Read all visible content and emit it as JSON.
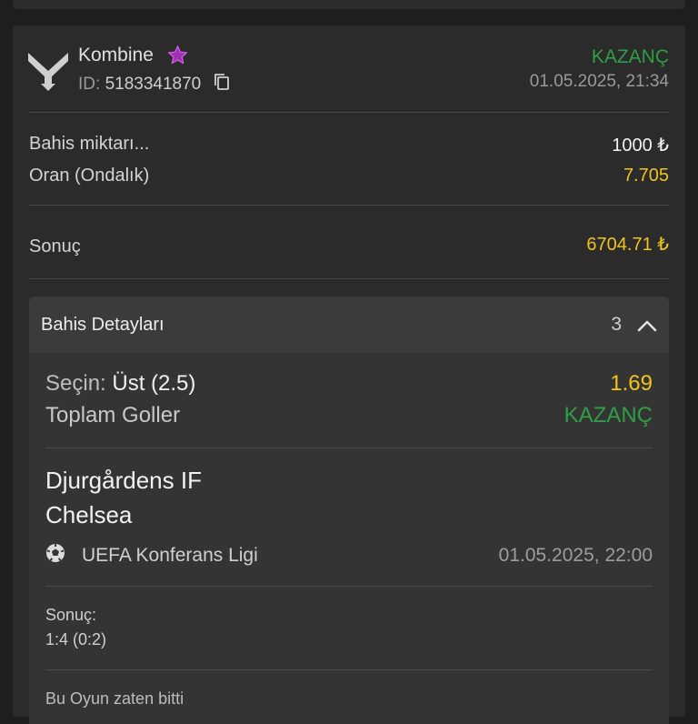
{
  "bet": {
    "type_label": "Kombine",
    "id_label": "ID:",
    "id_value": "5183341870",
    "status": "KAZANÇ",
    "placed_at": "01.05.2025, 21:34"
  },
  "summary": {
    "stake_label": "Bahis miktarı...",
    "stake_value": "1000 ₺",
    "odds_label": "Oran (Ondalık)",
    "odds_value": "7.705",
    "result_label": "Sonuç",
    "result_value": "6704.71 ₺"
  },
  "details": {
    "title": "Bahis Detayları",
    "count": "3",
    "selection": {
      "pick_label": "Seçin:",
      "pick_value": "Üst (2.5)",
      "odd": "1.69",
      "market": "Toplam Goller",
      "status": "KAZANÇ",
      "home_team": "Djurgårdens IF",
      "away_team": "Chelsea",
      "league": "UEFA Konferans Ligi",
      "match_date": "01.05.2025, 22:00",
      "result_label": "Sonuç:",
      "result_value": "1:4 (0:2)",
      "footer_note": "Bu Oyun zaten bitti"
    }
  },
  "colors": {
    "background": "#1e1e1e",
    "card": "#2b2b2b",
    "win_green": "#2f9e44",
    "odds_yellow": "#f0c419",
    "star_purple": "#9c2fb3"
  },
  "icons": [
    "brand-logo-icon",
    "star-icon",
    "copy-icon",
    "chevron-up-icon",
    "soccer-ball-icon"
  ]
}
